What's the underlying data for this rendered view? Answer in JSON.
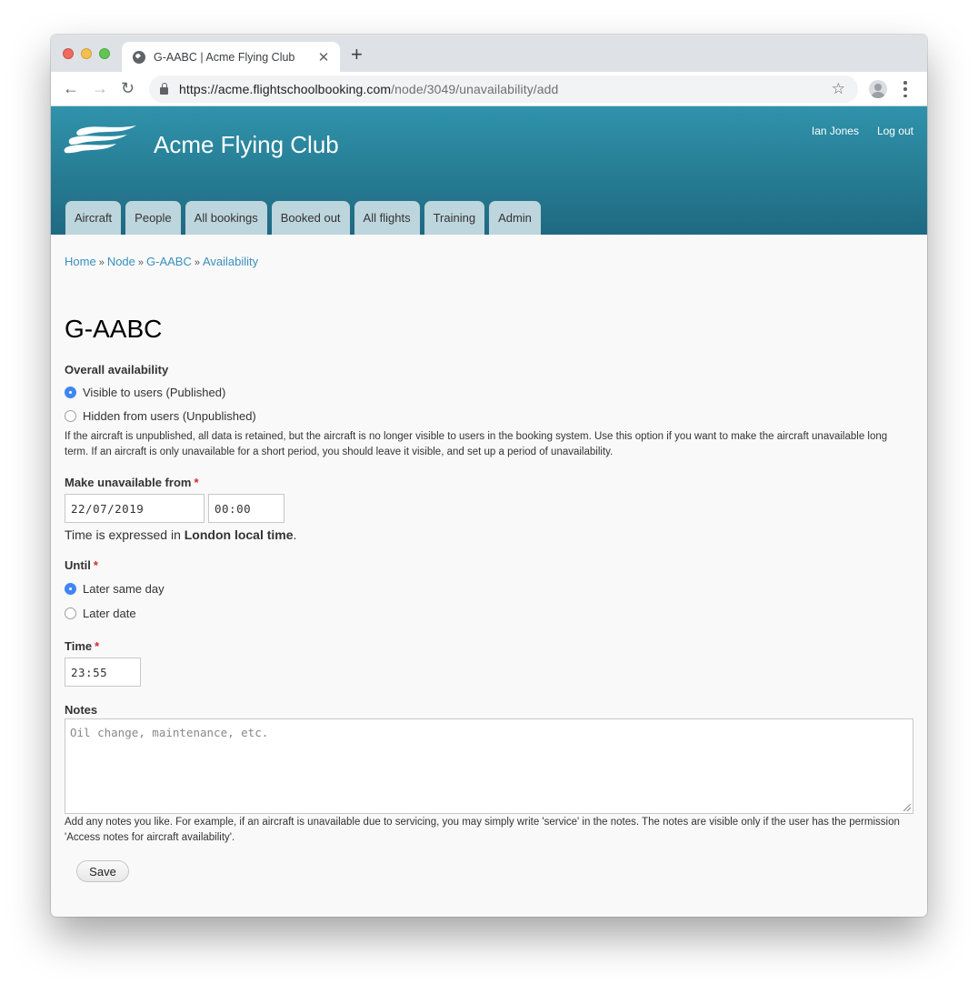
{
  "browser": {
    "tab_title": "G-AABC | Acme Flying Club",
    "url_host": "https://acme.flightschoolbooking.com",
    "url_path": "/node/3049/unavailability/add",
    "icons": {
      "back": "arrow-left-icon",
      "forward": "arrow-right-icon",
      "reload": "reload-icon",
      "lock": "lock-icon",
      "star": "star-icon",
      "profile": "profile-icon",
      "menu": "kebab-menu-icon",
      "new_tab": "plus-icon",
      "close_tab": "close-icon"
    }
  },
  "header": {
    "site_name": "Acme Flying Club",
    "user_name": "Ian Jones",
    "logout": "Log out",
    "brand_color": "#2a8aa3",
    "tabs": [
      {
        "label": "Aircraft"
      },
      {
        "label": "People"
      },
      {
        "label": "All bookings"
      },
      {
        "label": "Booked out"
      },
      {
        "label": "All flights"
      },
      {
        "label": "Training"
      },
      {
        "label": "Admin"
      }
    ]
  },
  "breadcrumb": {
    "items": [
      "Home",
      "Node",
      "G-AABC",
      "Availability"
    ],
    "separator": "»"
  },
  "page": {
    "title": "G-AABC"
  },
  "form": {
    "overall": {
      "label": "Overall availability",
      "options": [
        {
          "label": "Visible to users (Published)",
          "checked": true
        },
        {
          "label": "Hidden from users (Unpublished)",
          "checked": false
        }
      ],
      "description": "If the aircraft is unpublished, all data is retained, but the aircraft is no longer visible to users in the booking system. Use this option if you want to make the aircraft unavailable long term. If an aircraft is only unavailable for a short period, you should leave it visible, and set up a period of unavailability."
    },
    "from": {
      "label": "Make unavailable from",
      "required_mark": "*",
      "date_value": "22/07/2019",
      "time_value": "00:00",
      "tz_prefix": "Time is expressed in ",
      "tz_bold": "London local time",
      "tz_suffix": "."
    },
    "until": {
      "label": "Until",
      "required_mark": "*",
      "options": [
        {
          "label": "Later same day",
          "checked": true
        },
        {
          "label": "Later date",
          "checked": false
        }
      ]
    },
    "time": {
      "label": "Time",
      "required_mark": "*",
      "value": "23:55"
    },
    "notes": {
      "label": "Notes",
      "placeholder": "Oil change, maintenance, etc.",
      "description": "Add any notes you like. For example, if an aircraft is unavailable due to servicing, you may simply write 'service' in the notes. The notes are visible only if the user has the permission 'Access notes for aircraft availability'."
    },
    "save_label": "Save"
  }
}
